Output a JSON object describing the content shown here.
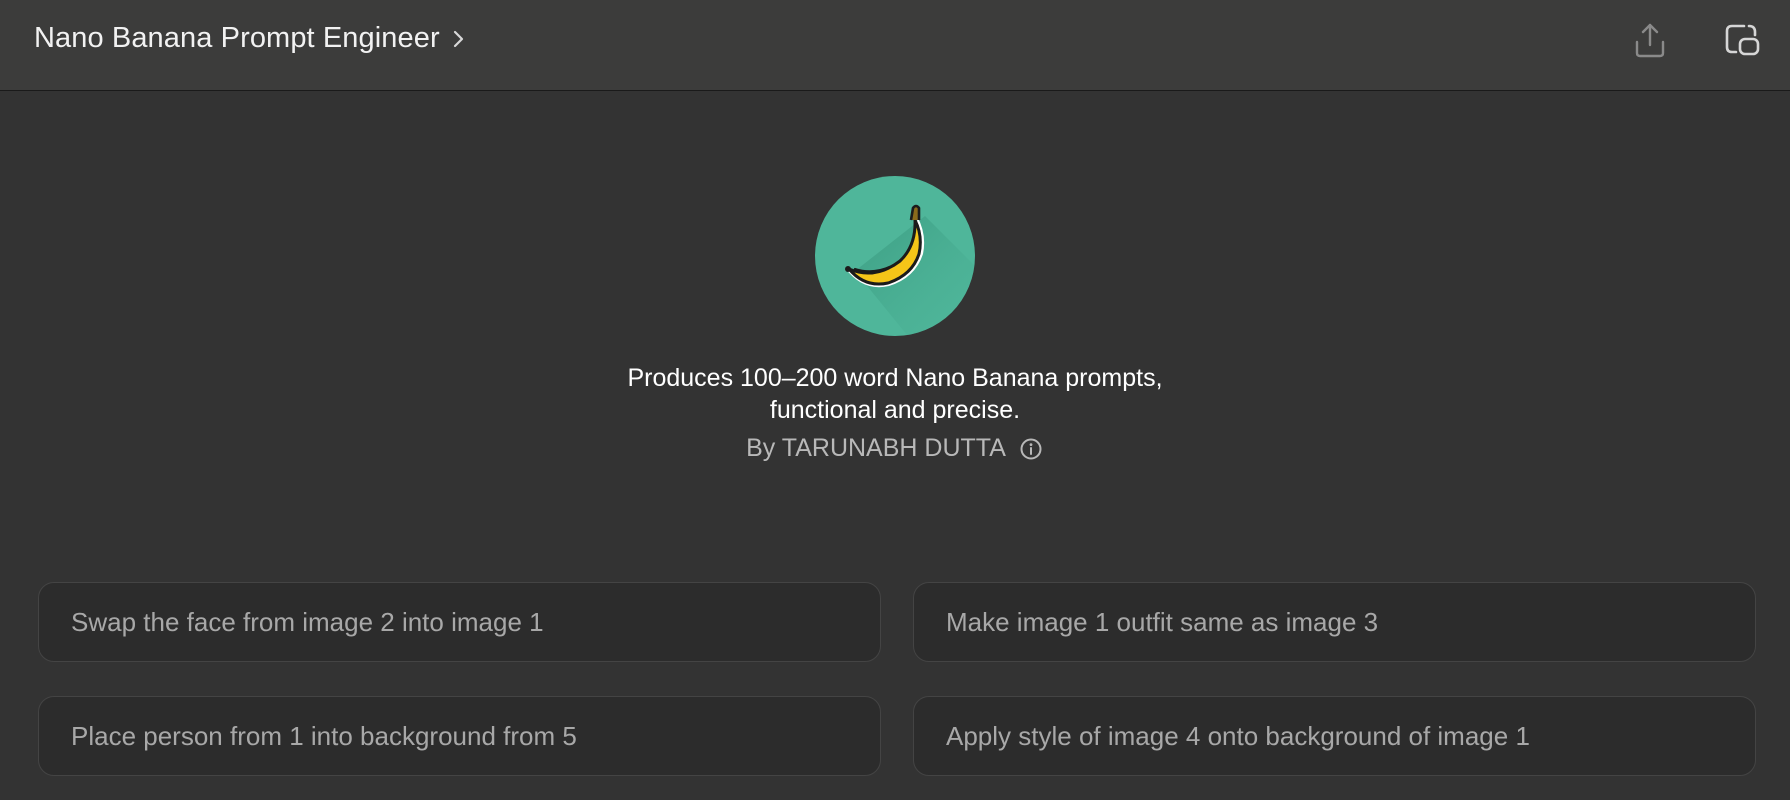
{
  "header": {
    "title": "Nano Banana Prompt Engineer",
    "icons": {
      "title_chevron": "chevron-right-icon",
      "share": "share-icon",
      "new_chat": "new-chat-icon"
    }
  },
  "gpt": {
    "avatar_icon": "banana-icon",
    "description_line1": "Produces 100–200 word Nano Banana prompts,",
    "description_line2": "functional and precise.",
    "author": "By TARUNABH DUTTA",
    "info_icon": "info-icon"
  },
  "prompts": [
    {
      "label": "Swap the face from image 2 into image 1"
    },
    {
      "label": "Make image 1 outfit same as image 3"
    },
    {
      "label": "Place person from 1 into background from 5"
    },
    {
      "label": "Apply style of image 4 onto background of image 1"
    }
  ],
  "colors": {
    "background": "#333333",
    "header_bg": "#3c3c3b",
    "avatar_bg": "#4fb69a",
    "banana_yellow": "#f5c518",
    "card_bg": "#2c2c2c",
    "card_text": "#a8a8a8"
  }
}
